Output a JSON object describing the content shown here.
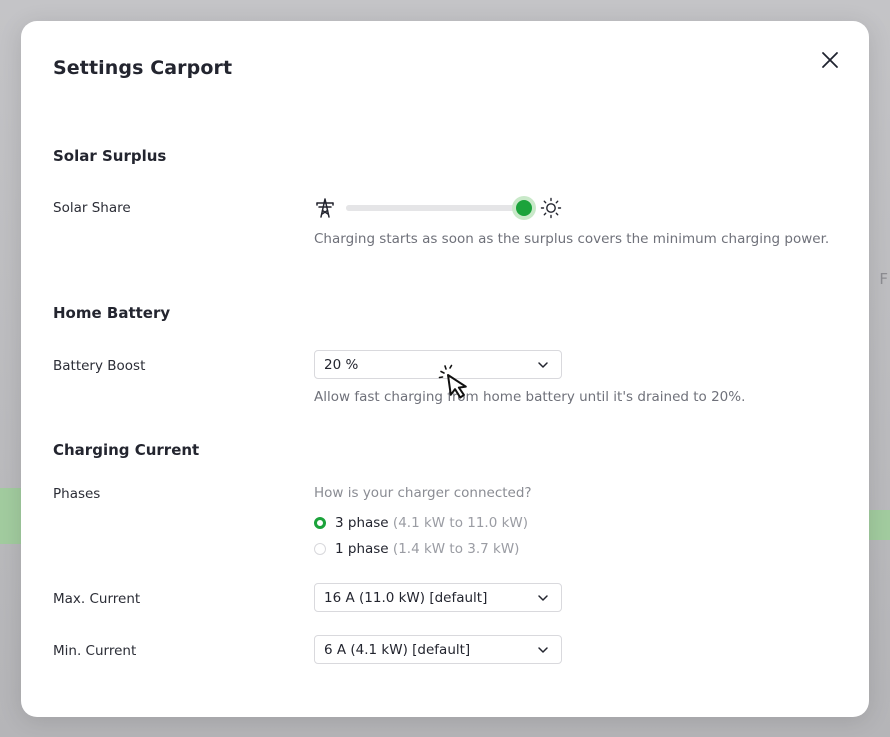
{
  "backdrop": {
    "ghost_text": "F"
  },
  "modal": {
    "title": "Settings Carport",
    "close_label": "Close"
  },
  "solar_surplus": {
    "title": "Solar Surplus",
    "solar_share": {
      "label": "Solar Share",
      "value_fraction": 1.0,
      "left_icon": "power-pylon-icon",
      "right_icon": "sun-icon",
      "help": "Charging starts as soon as the surplus covers the minimum charging power."
    }
  },
  "home_battery": {
    "title": "Home Battery",
    "battery_boost": {
      "label": "Battery Boost",
      "value": "20 %",
      "help": "Allow fast charging from home battery until it's drained to 20%."
    }
  },
  "charging_current": {
    "title": "Charging Current",
    "phases": {
      "label": "Phases",
      "question": "How is your charger connected?",
      "options": [
        {
          "label": "3 phase",
          "range": "(4.1 kW to 11.0 kW)",
          "checked": true
        },
        {
          "label": "1 phase",
          "range": "(1.4 kW to 3.7 kW)",
          "checked": false
        }
      ]
    },
    "max_current": {
      "label": "Max. Current",
      "value": "16 A (11.0 kW) [default]"
    },
    "min_current": {
      "label": "Min. Current",
      "value": "6 A (4.1 kW) [default]"
    }
  },
  "colors": {
    "accent_green": "#1ba33b",
    "text_dark": "#23252f",
    "text_muted": "#6f717a"
  }
}
